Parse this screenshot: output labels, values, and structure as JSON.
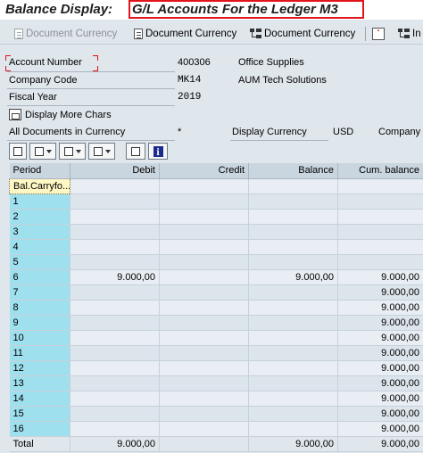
{
  "title": {
    "prefix": "Balance Display:",
    "highlighted": "G/L Accounts For the Ledger M3"
  },
  "toolbar": {
    "items": [
      {
        "label": "Document Currency",
        "enabled": false,
        "icon": "document-icon"
      },
      {
        "label": "Document Currency",
        "enabled": true,
        "icon": "document-icon"
      },
      {
        "label": "Document Currency",
        "enabled": true,
        "icon": "hierarchy-icon"
      },
      {
        "label": "In",
        "enabled": true,
        "icon": "hierarchy-icon"
      }
    ]
  },
  "header": {
    "account_number": {
      "label": "Account Number",
      "value": "400306",
      "description": "Office Supplies"
    },
    "company_code": {
      "label": "Company Code",
      "value": "MK14",
      "description": "AUM Tech Solutions"
    },
    "fiscal_year": {
      "label": "Fiscal Year",
      "value": "2019"
    },
    "more_chars_label": "Display More Chars",
    "all_docs": {
      "label": "All Documents in Currency",
      "value": "*"
    },
    "display_currency": {
      "label": "Display Currency",
      "value": "USD"
    },
    "company_trunc": "Company c"
  },
  "grid": {
    "columns": [
      "Period",
      "Debit",
      "Credit",
      "Balance",
      "Cum. balance"
    ],
    "rows": [
      {
        "period": "Bal.Carryfo...",
        "debit": "",
        "credit": "",
        "balance": "",
        "cum": ""
      },
      {
        "period": "1",
        "debit": "",
        "credit": "",
        "balance": "",
        "cum": ""
      },
      {
        "period": "2",
        "debit": "",
        "credit": "",
        "balance": "",
        "cum": ""
      },
      {
        "period": "3",
        "debit": "",
        "credit": "",
        "balance": "",
        "cum": ""
      },
      {
        "period": "4",
        "debit": "",
        "credit": "",
        "balance": "",
        "cum": ""
      },
      {
        "period": "5",
        "debit": "",
        "credit": "",
        "balance": "",
        "cum": ""
      },
      {
        "period": "6",
        "debit": "9.000,00",
        "credit": "",
        "balance": "9.000,00",
        "cum": "9.000,00"
      },
      {
        "period": "7",
        "debit": "",
        "credit": "",
        "balance": "",
        "cum": "9.000,00"
      },
      {
        "period": "8",
        "debit": "",
        "credit": "",
        "balance": "",
        "cum": "9.000,00"
      },
      {
        "period": "9",
        "debit": "",
        "credit": "",
        "balance": "",
        "cum": "9.000,00"
      },
      {
        "period": "10",
        "debit": "",
        "credit": "",
        "balance": "",
        "cum": "9.000,00"
      },
      {
        "period": "11",
        "debit": "",
        "credit": "",
        "balance": "",
        "cum": "9.000,00"
      },
      {
        "period": "12",
        "debit": "",
        "credit": "",
        "balance": "",
        "cum": "9.000,00"
      },
      {
        "period": "13",
        "debit": "",
        "credit": "",
        "balance": "",
        "cum": "9.000,00"
      },
      {
        "period": "14",
        "debit": "",
        "credit": "",
        "balance": "",
        "cum": "9.000,00"
      },
      {
        "period": "15",
        "debit": "",
        "credit": "",
        "balance": "",
        "cum": "9.000,00"
      },
      {
        "period": "16",
        "debit": "",
        "credit": "",
        "balance": "",
        "cum": "9.000,00"
      }
    ],
    "total": {
      "period": "Total",
      "debit": "9.000,00",
      "credit": "",
      "balance": "9.000,00",
      "cum": "9.000,00"
    }
  },
  "colors": {
    "highlight_border": "#e0141a",
    "period_column": "#9fe0ee",
    "background": "#dfe6ec"
  }
}
